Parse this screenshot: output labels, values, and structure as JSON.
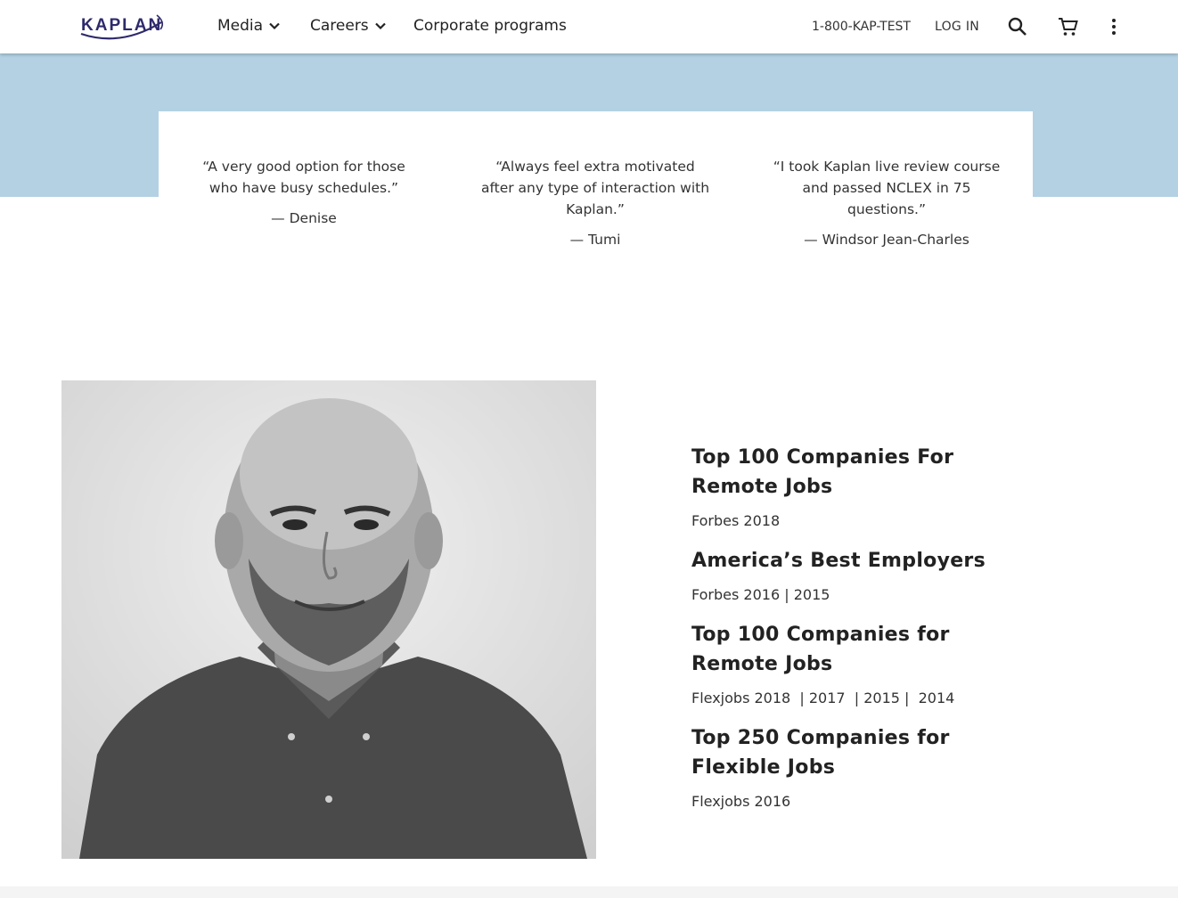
{
  "header": {
    "logo_text": "KAPLAN",
    "nav": [
      {
        "label": "Media"
      },
      {
        "label": "Careers"
      },
      {
        "label": "Corporate programs"
      }
    ],
    "phone": "1-800-KAP-TEST",
    "login": "LOG IN",
    "icons": [
      "search-icon",
      "cart-icon",
      "more-vert-icon"
    ]
  },
  "testimonials": [
    {
      "quote": "“A very good option for those who have busy schedules.”",
      "author": "— Denise"
    },
    {
      "quote": "“Always feel extra motivated after any type of interaction with Kaplan.”",
      "author": "— Tumi"
    },
    {
      "quote": "“I took Kaplan live review course and passed NCLEX in 75 questions.”",
      "author": "— Windsor Jean-Charles"
    }
  ],
  "awards": [
    {
      "title": "Top 100 Companies For Remote Jobs",
      "source": "Forbes 2018"
    },
    {
      "title": "America’s Best Employers",
      "source": "Forbes 2016 | 2015"
    },
    {
      "title": "Top 100 Companies for Remote Jobs",
      "source": "Flexjobs 2018  | 2017  | 2015 |  2014"
    },
    {
      "title": "Top 250 Companies for Flexible Jobs",
      "source": "Flexjobs 2016"
    }
  ],
  "colors": {
    "band": "#b3d1e3",
    "logo": "#2e2a6b"
  }
}
